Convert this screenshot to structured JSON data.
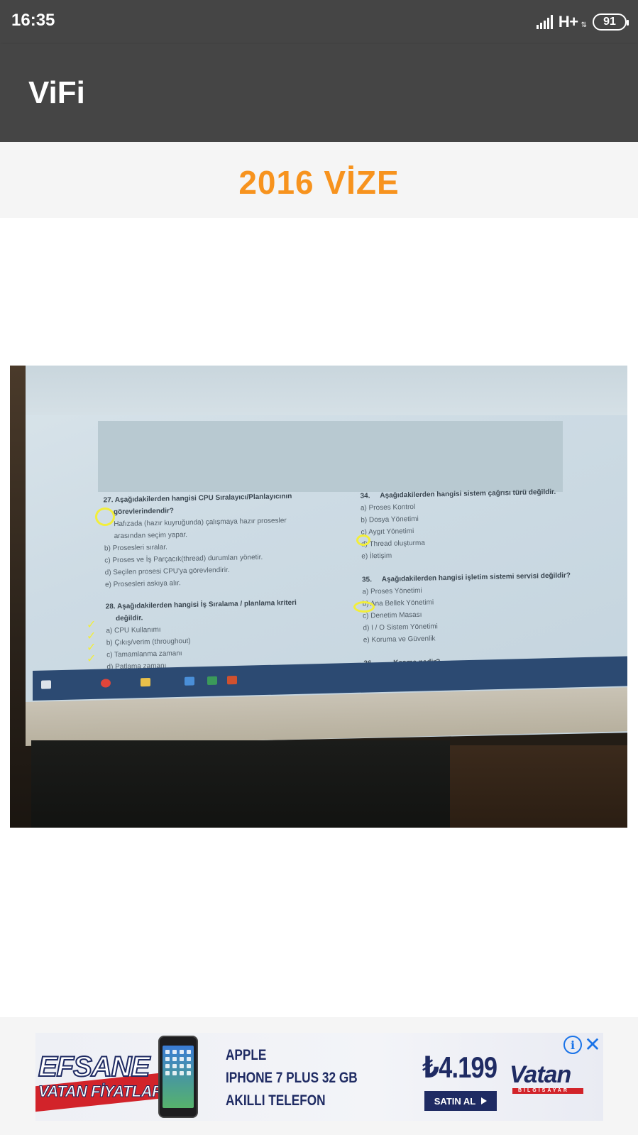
{
  "status_bar": {
    "time": "16:35",
    "network": "H+",
    "network_arrows": "⇅",
    "battery": "91"
  },
  "app_bar": {
    "title": "ViFi"
  },
  "section": {
    "title": "2016 VİZE"
  },
  "photo": {
    "left_column": {
      "q27_title": "27. Aşağıdakilerden hangisi CPU Sıralayıcı/Planlayıcının",
      "q27_title_2": "görevlerindendir?",
      "q27_a": "Hafızada (hazır kuyruğunda) çalışmaya hazır prosesler",
      "q27_a2": "arasından seçim yapar.",
      "q27_b": "b)  Prosesleri sıralar.",
      "q27_c": "c)  Proses ve İş Parçacık(thread) durumları yönetir.",
      "q27_d": "d)  Seçilen prosesi CPU'ya görevlendirir.",
      "q27_e": "e)  Prosesleri askıya alır.",
      "q28_title": "28. Aşağıdakilerden hangisi İş Sıralama / planlama kriteri",
      "q28_title_2": "değildir.",
      "q28_a": "a)  CPU Kullanımı",
      "q28_b": "b)  Çıkış/verim (throughout)",
      "q28_c": "c)  Tamamlanma zamanı",
      "q28_d": "d)  Patlama zamanı"
    },
    "right_column": {
      "q34_num": "34.",
      "q34_title": "Aşağıdakilerden hangisi sistem çağrısı türü değildir.",
      "q34_a": "a) Proses Kontrol",
      "q34_b": "b) Dosya Yönetimi",
      "q34_c": "c) Aygıt Yönetimi",
      "q34_d": "d) Thread oluşturma",
      "q34_e": "e) İletişim",
      "q35_num": "35.",
      "q35_title": "Aşağıdakilerden hangisi işletim sistemi servisi değildir?",
      "q35_a": "a)  Proses Yönetimi",
      "q35_b": "b)  Ana Bellek Yönetimi",
      "q35_c": "c)  Denetim Masası",
      "q35_d": "d)  I / O Sistem Yönetimi",
      "q35_e": "e)  Koruma ve Güvenlik",
      "q36_num": "36.",
      "q36_title": "Kesme nedir?"
    }
  },
  "ad": {
    "headline": "EFSANE",
    "subline": "VATAN FİYATLARI",
    "brand_line": "APPLE",
    "product_line": "IPHONE 7 PLUS 32 GB",
    "type_line": "AKILLI TELEFON",
    "price": "₺4.199",
    "cta": "SATIN AL",
    "brand": "Vatan",
    "brand_sub": "BİLGİSAYAR",
    "info_icon": "i",
    "close_icon": "✕",
    "colors": {
      "navy": "#1f2b63",
      "red": "#d2232a",
      "info_blue": "#1a73e8"
    }
  },
  "colors": {
    "status_bar": "#454545",
    "section_title": "#f7931e"
  }
}
